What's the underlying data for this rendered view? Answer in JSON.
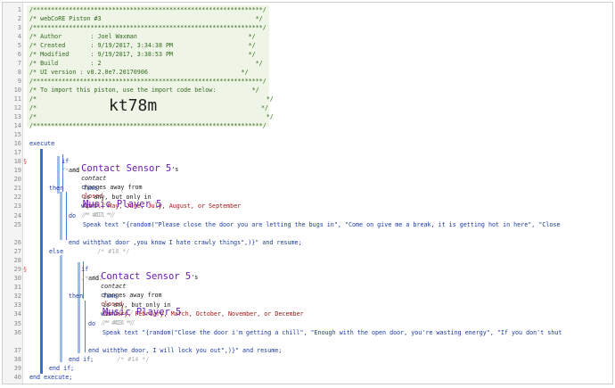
{
  "header": {
    "stars": "/****************************************************************/",
    "title": "/* webCoRE Piston #3                                           */",
    "author": "/* Author        : Joel Waxman                               */",
    "created": "/* Created       : 9/19/2017, 3:34:38 PM                     */",
    "modified": "/* Modified      : 9/19/2017, 3:38:53 PM                     */",
    "build": "/* Build         : 2                                           */",
    "ui_version": "/* UI version : v0.2.0e7.20170906                          */",
    "import_note": "/* To import this piston, use the import code below:          */",
    "blank_a": "/*                                                                */",
    "code_prefix": "/*",
    "code_suffix": "*/",
    "import_code": "kt78m",
    "blank_b": "/*                                                                */"
  },
  "line_numbers": [
    "1",
    "2",
    "3",
    "4",
    "5",
    "6",
    "7",
    "8",
    "9",
    "10",
    "11",
    "12",
    "13",
    "14",
    "15",
    "16",
    "17",
    "18",
    "19",
    "20",
    "21",
    "22",
    "23",
    "24",
    "25",
    "26",
    "27",
    "28",
    "29",
    "30",
    "31",
    "32",
    "33",
    "34",
    "35",
    "36",
    "37",
    "38",
    "39",
    "40"
  ],
  "markers": [
    "§",
    "§"
  ],
  "code": {
    "execute": "execute",
    "if1": "if",
    "if1_c": "/* #1 */",
    "dev1": "Contact Sensor 5",
    "apos_s": "'s",
    "contact": "contact",
    "changes_away": "changes away from",
    "closed": "closed",
    "c4": "/* #4 */",
    "and": "and",
    "time": "Time",
    "is_any_only_in": "is any, but only in",
    "months1": "April, May, June, July, August, or September",
    "c11": "/* #11 */",
    "then": "then",
    "with": "with",
    "c17": "/* #17 */",
    "dev2": "Music Player 5",
    "do": "do",
    "speak1_a": "Speak text \"{random(\"Please close the door you are letting the bugs in\", \"Come on give me a break, it is getting hot in here\", \"Close",
    "speak1_b": "that door ,you know I hate crawly things\",)}\" and resume;",
    "c18": "/* #18 */",
    "end_with": "end with;",
    "else": "else",
    "if2": "if",
    "c12": "/* #12 */",
    "c15": "/* #15 */",
    "months2": "January, February, March, October, November, or December",
    "c16": "/* #16 */",
    "c13": "/* #13 */",
    "speak2_a": "Speak text \"{random(\"Close the door i'm getting a chill\", \"Enough with the open door, you're wasting energy\", \"If you don't shut",
    "speak2_b": "the door, I will lock you out\",)}\" and resume;",
    "c14": "/* #14 */",
    "end_if": "end if;",
    "end_execute": "end execute;"
  }
}
